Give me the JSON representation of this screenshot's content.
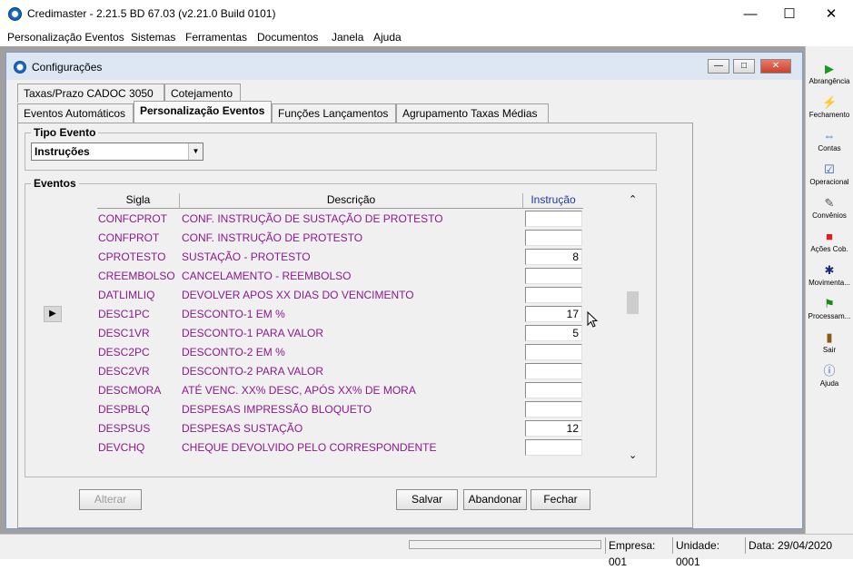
{
  "window": {
    "title": "Credimaster - 2.21.5 BD 67.03 (v2.21.0 Build 0101)"
  },
  "menu": [
    "Personalização Eventos",
    "Sistemas",
    "Ferramentas",
    "Documentos",
    "Janela",
    "Ajuda"
  ],
  "toolbar": [
    {
      "label": "Abrangência",
      "icon": "play-icon"
    },
    {
      "label": "Fechamento",
      "icon": "lightning-icon"
    },
    {
      "label": "Contas",
      "icon": "arrows-icon"
    },
    {
      "label": "Operacional",
      "icon": "checklist-icon"
    },
    {
      "label": "Convênios",
      "icon": "document-check-icon"
    },
    {
      "label": "Ações Cob.",
      "icon": "stop-icon"
    },
    {
      "label": "Movimenta...",
      "icon": "runner-icon"
    },
    {
      "label": "Processam...",
      "icon": "flag-icon"
    },
    {
      "label": "Sair",
      "icon": "exit-door-icon"
    },
    {
      "label": "Ajuda",
      "icon": "help-icon"
    }
  ],
  "child_window": {
    "title": "Configurações"
  },
  "tabs_row1": [
    "Taxas/Prazo CADOC 3050",
    "Cotejamento"
  ],
  "tabs_row2": [
    "Eventos Automáticos",
    "Personalização Eventos",
    "Funções Lançamentos",
    "Agrupamento Taxas Médias"
  ],
  "tipo_evento": {
    "label": "Tipo Evento",
    "selected": "Instruções"
  },
  "eventos": {
    "label": "Eventos",
    "headers": {
      "sigla": "Sigla",
      "descricao": "Descrição",
      "instrucao": "Instrução"
    },
    "current_row": 5,
    "rows": [
      {
        "sigla": "CONFCPROT",
        "descricao": "CONF. INSTRUÇÃO DE SUSTAÇÃO DE PROTESTO",
        "instrucao": ""
      },
      {
        "sigla": "CONFPROT",
        "descricao": "CONF. INSTRUÇÃO DE PROTESTO",
        "instrucao": ""
      },
      {
        "sigla": "CPROTESTO",
        "descricao": "SUSTAÇÃO - PROTESTO",
        "instrucao": "8"
      },
      {
        "sigla": "CREEMBOLSO",
        "descricao": "CANCELAMENTO - REEMBOLSO",
        "instrucao": ""
      },
      {
        "sigla": "DATLIMLIQ",
        "descricao": "DEVOLVER APOS XX DIAS DO VENCIMENTO",
        "instrucao": ""
      },
      {
        "sigla": "DESC1PC",
        "descricao": "DESCONTO-1 EM %",
        "instrucao": "17"
      },
      {
        "sigla": "DESC1VR",
        "descricao": "DESCONTO-1 PARA VALOR",
        "instrucao": "5"
      },
      {
        "sigla": "DESC2PC",
        "descricao": "DESCONTO-2 EM %",
        "instrucao": ""
      },
      {
        "sigla": "DESC2VR",
        "descricao": "DESCONTO-2 PARA VALOR",
        "instrucao": ""
      },
      {
        "sigla": "DESCMORA",
        "descricao": "ATÉ VENC. XX% DESC, APÓS XX% DE MORA",
        "instrucao": ""
      },
      {
        "sigla": "DESPBLQ",
        "descricao": "DESPESAS IMPRESSÃO BLOQUETO",
        "instrucao": ""
      },
      {
        "sigla": "DESPSUS",
        "descricao": "DESPESAS SUSTAÇÃO",
        "instrucao": "12"
      },
      {
        "sigla": "DEVCHQ",
        "descricao": "CHEQUE DEVOLVIDO PELO CORRESPONDENTE",
        "instrucao": ""
      }
    ]
  },
  "buttons": {
    "alterar": "Alterar",
    "salvar": "Salvar",
    "abandonar": "Abandonar",
    "fechar": "Fechar"
  },
  "status": {
    "empresa": "Empresa: 001",
    "unidade": "Unidade: 0001",
    "data": "Data:  29/04/2020"
  }
}
